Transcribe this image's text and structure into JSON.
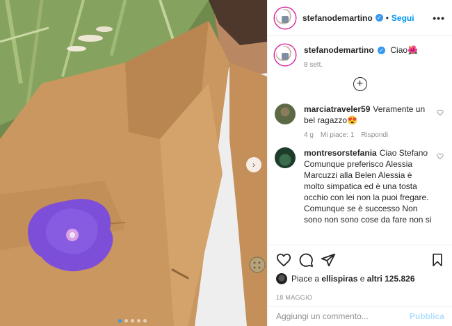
{
  "post": {
    "username": "stefanodemartino",
    "follow_label": "Segui",
    "separator": "•",
    "more_label": "•••",
    "verified_mark": "✓"
  },
  "caption": {
    "username": "stefanodemartino",
    "text": "Ciao",
    "emoji": "🌺",
    "time": "8 sett."
  },
  "comments": [
    {
      "username": "marciatraveler59",
      "text": "Veramente un bel ragazzo😍",
      "time": "4 g",
      "likes": "Mi piace: 1",
      "reply": "Rispondi"
    },
    {
      "username": "montresorstefania",
      "text": "Ciao Stefano Comunque preferisco Alessia Marcuzzi alla Belen Alessia è molto simpatica ed è una tosta occhio con lei non la puoi fregare. Comunque se è successo Non sono non sono cose da fare non si"
    }
  ],
  "load_more_label": "+",
  "likes": {
    "prefix": "Piace a",
    "user": "ellispiras",
    "middle": "e",
    "others": "altri 125.826"
  },
  "date": "18 MAGGIO",
  "add_comment": {
    "placeholder": "Aggiungi un commento...",
    "publish_label": "Pubblica"
  },
  "carousel": {
    "count": 5,
    "active": 0,
    "next_icon": "›"
  },
  "icons": [
    "heart-icon",
    "comment-icon",
    "share-icon",
    "bookmark-icon",
    "plus-circle-icon",
    "chevron-right-icon"
  ],
  "colors": {
    "link": "#0095f6",
    "verified": "#3897f0",
    "publish_disabled": "#b2dffc",
    "meta": "#8e8e8e"
  }
}
